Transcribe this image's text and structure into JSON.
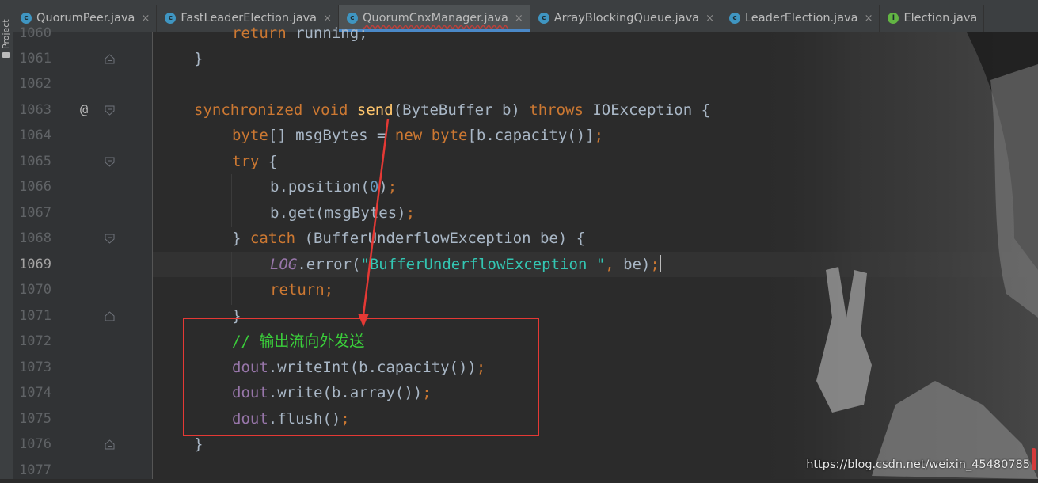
{
  "sidebar": {
    "project_label": "Project"
  },
  "tabs": [
    {
      "label": "QuorumPeer.java",
      "icon": "class-icon",
      "active": false,
      "close": "×"
    },
    {
      "label": "FastLeaderElection.java",
      "icon": "class-icon",
      "active": false,
      "close": "×"
    },
    {
      "label": "QuorumCnxManager.java",
      "icon": "class-icon",
      "active": true,
      "close": "×"
    },
    {
      "label": "ArrayBlockingQueue.java",
      "icon": "class-icon",
      "active": false,
      "close": "×"
    },
    {
      "label": "LeaderElection.java",
      "icon": "class-icon",
      "active": false,
      "close": "×"
    },
    {
      "label": "Election.java",
      "icon": "interface-icon",
      "active": false,
      "close": ""
    }
  ],
  "lines": {
    "l1060": "1060",
    "l1061": "1061",
    "l1062": "1062",
    "l1063": "1063",
    "l1064": "1064",
    "l1065": "1065",
    "l1066": "1066",
    "l1067": "1067",
    "l1068": "1068",
    "l1069": "1069",
    "l1070": "1070",
    "l1071": "1071",
    "l1072": "1072",
    "l1073": "1073",
    "l1074": "1074",
    "l1075": "1075",
    "l1076": "1076",
    "l1077": "1077"
  },
  "code": {
    "c1060": {
      "a": "return",
      "b": " running;"
    },
    "c1061": "}",
    "c1063": {
      "k1": "synchronized",
      "k2": " void ",
      "fn": "send",
      "p": "(ByteBuffer b) ",
      "k3": "throws",
      "rest": " IOException {"
    },
    "c1064": {
      "k1": "byte",
      "a": "[] msgBytes = ",
      "k2": "new",
      "k3": " byte",
      "b": "[b.capacity()]",
      "semi": ";"
    },
    "c1065": {
      "k": "try",
      "rest": " {"
    },
    "c1066": {
      "a": "b.position(",
      "n": "0",
      "b": ")",
      "semi": ";"
    },
    "c1067": {
      "a": "b.get(msgBytes)",
      "semi": ";"
    },
    "c1068": {
      "a": "} ",
      "k": "catch",
      "b": " (BufferUnderflowException be) {"
    },
    "c1069": {
      "log": "LOG",
      "a": ".error(",
      "str": "\"BufferUnderflowException \"",
      "sep": ", ",
      "b": "be)",
      "semi": ";"
    },
    "c1070": {
      "k": "return",
      "semi": ";"
    },
    "c1071": "}",
    "c1072": "// 输出流向外发送",
    "c1073": {
      "f": "dout",
      "a": ".writeInt(b.capacity())",
      "semi": ";"
    },
    "c1074": {
      "f": "dout",
      "a": ".write(b.array())",
      "semi": ";"
    },
    "c1075": {
      "f": "dout",
      "a": ".flush()",
      "semi": ";"
    },
    "c1076": "}"
  },
  "gutter": {
    "override_marker": "@"
  },
  "watermark": "https://blog.csdn.net/weixin_45480785",
  "colors": {
    "keyword": "#cc7832",
    "function": "#ffc66d",
    "number": "#6897bb",
    "field": "#9876aa",
    "comment": "#3bd13b",
    "annotation_box": "#e53935"
  }
}
